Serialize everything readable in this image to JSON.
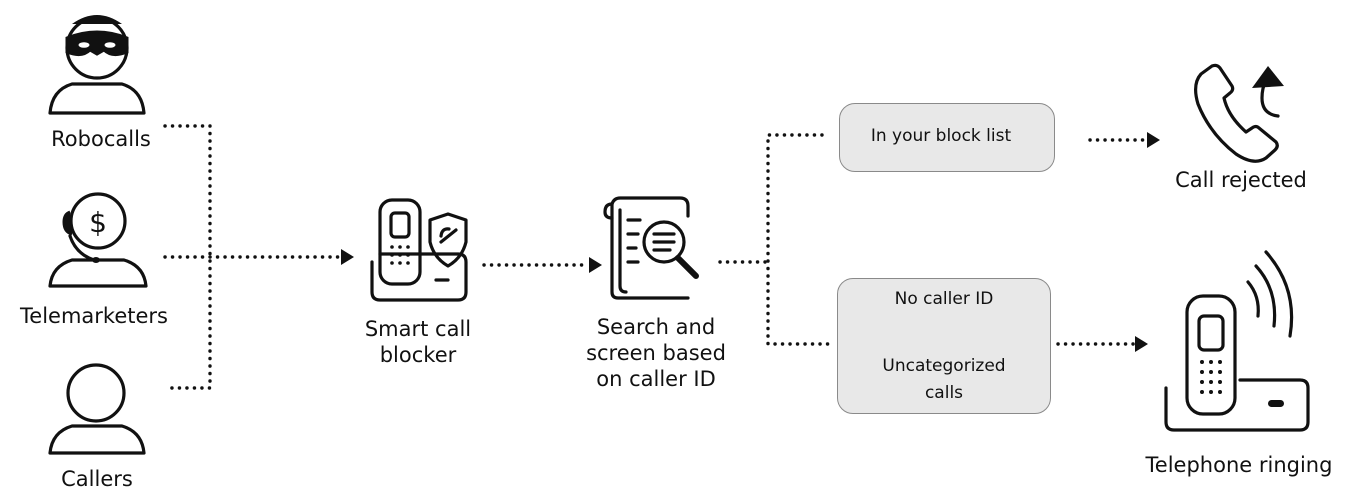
{
  "sources": {
    "robocalls": "Robocalls",
    "telemarketers": "Telemarketers",
    "callers": "Callers"
  },
  "blocker": {
    "line1": "Smart call",
    "line2": "blocker"
  },
  "screen": {
    "line1": "Search and",
    "line2": "screen based",
    "line3": "on caller ID"
  },
  "block_list_box": {
    "text": "In your block list"
  },
  "allowed_box": {
    "line1": "No caller ID",
    "line2": "Uncategorized",
    "line3": "calls"
  },
  "outcomes": {
    "rejected": "Call rejected",
    "ringing": "Telephone ringing"
  },
  "icons": {
    "robocalls": "masked-person-icon",
    "telemarketers": "headset-dollar-person-icon",
    "callers": "person-icon",
    "blocker": "cordless-phone-shield-icon",
    "screen": "document-magnifier-icon",
    "rejected": "handset-return-arrow-icon",
    "ringing": "ringing-phone-icon"
  }
}
